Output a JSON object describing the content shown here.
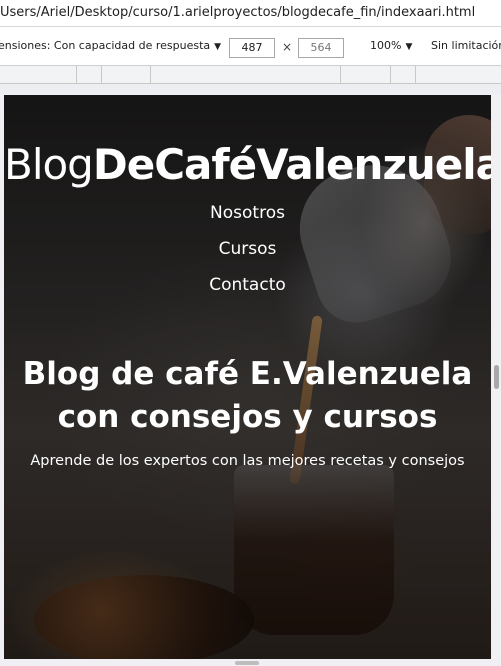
{
  "browser": {
    "address": "Users/Ariel/Desktop/curso/1.arielproyectos/blogdecafe_fin/indexaari.html"
  },
  "device_toolbar": {
    "dimensions_label": "ensiones: Con capacidad de respuesta",
    "width_value": "487",
    "times_symbol": "×",
    "height_value": "564",
    "zoom": "100%",
    "throttling": "Sin limitación"
  },
  "page": {
    "logo_light": "Blog",
    "logo_bold": "DeCaféValenzuela",
    "nav": [
      "Nosotros",
      "Cursos",
      "Contacto"
    ],
    "hero_title": "Blog de café E.Valenzuela con consejos y cursos",
    "hero_subtitle": "Aprende de los expertos con las mejores recetas y consejos"
  },
  "icons": {
    "dropdown": "caret-down-icon"
  },
  "colors": {
    "hero_text": "#ffffff",
    "toolbar_bg": "#ffffff"
  }
}
